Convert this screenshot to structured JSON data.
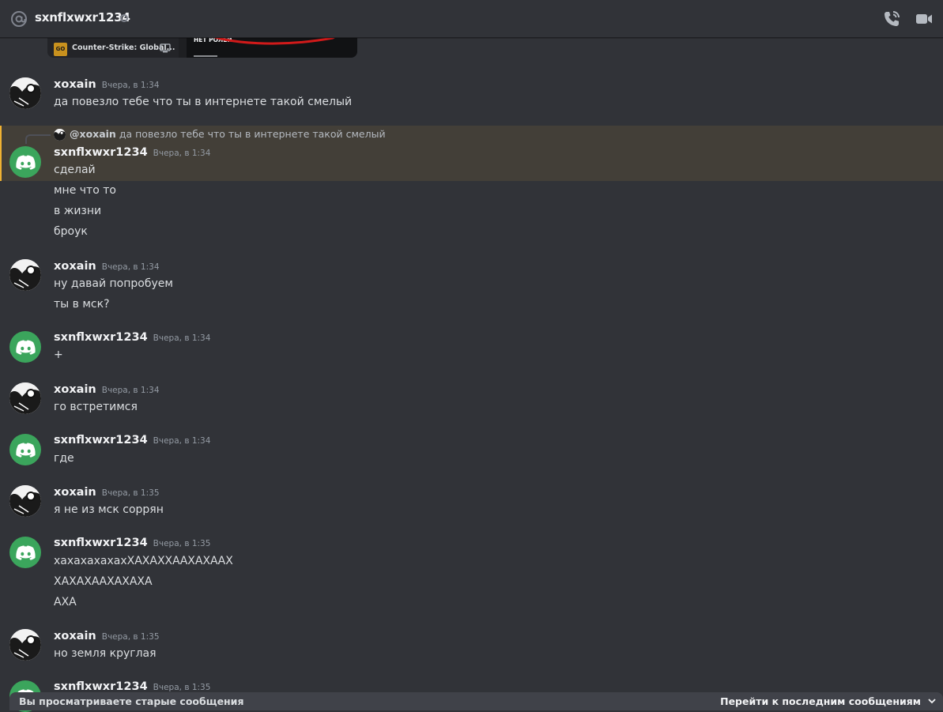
{
  "header": {
    "title": "sxnflxwxr1234"
  },
  "embed": {
    "game": "Counter-Strike: Global...",
    "badge": "GO",
    "roles_text": "НЕТ РОЛЕЙ"
  },
  "reply": {
    "author": "@xoxain",
    "text": "да повезло тебе что ты в интернете такой смелый"
  },
  "messages": [
    {
      "author": "xoxain",
      "time": "Вчера, в 1:34",
      "lines": [
        "да повезло тебе что ты в интернете такой смелый"
      ]
    },
    {
      "author": "sxnflxwxr1234",
      "time": "Вчера, в 1:34",
      "lines": [
        "сделай",
        "мне что то",
        "в жизни",
        "броук"
      ]
    },
    {
      "author": "xoxain",
      "time": "Вчера, в 1:34",
      "lines": [
        "ну давай попробуем",
        "ты в мск?"
      ]
    },
    {
      "author": "sxnflxwxr1234",
      "time": "Вчера, в 1:34",
      "lines": [
        "+"
      ]
    },
    {
      "author": "xoxain",
      "time": "Вчера, в 1:34",
      "lines": [
        "го встретимся"
      ]
    },
    {
      "author": "sxnflxwxr1234",
      "time": "Вчера, в 1:34",
      "lines": [
        "где"
      ]
    },
    {
      "author": "xoxain",
      "time": "Вчера, в 1:35",
      "lines": [
        "я не из мск соррян"
      ]
    },
    {
      "author": "sxnflxwxr1234",
      "time": "Вчера, в 1:35",
      "lines": [
        "хахахахахахХАХАХХААХАХААХ",
        "ХАХАХААХАХАХА",
        "АХА"
      ]
    },
    {
      "author": "xoxain",
      "time": "Вчера, в 1:35",
      "lines": [
        "но земля круглая"
      ]
    },
    {
      "author": "sxnflxwxr1234",
      "time": "Вчера, в 1:35",
      "lines": []
    }
  ],
  "bottom_bar": {
    "left": "Вы просматриваете старые сообщения",
    "right": "Перейти к последним сообщениям"
  },
  "colors": {
    "background": "#313338",
    "discord_green": "#3ba55c",
    "mention_highlight": "#433f38",
    "mention_bar": "#f0b232"
  }
}
